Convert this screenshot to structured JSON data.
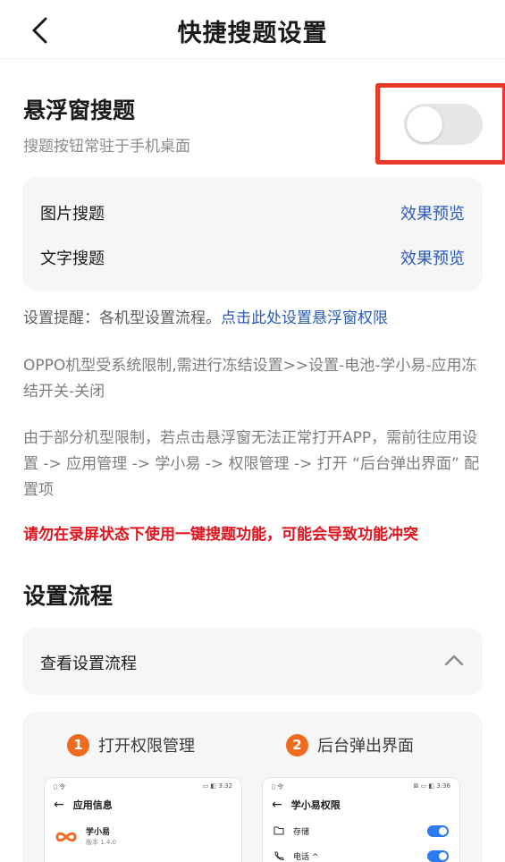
{
  "header": {
    "title": "快捷搜题设置",
    "back_icon": "chevron-left-icon"
  },
  "floating": {
    "title": "悬浮窗搜题",
    "subtitle": "搜题按钮常驻于手机桌面",
    "toggle_on": false,
    "highlight_color": "#e8392b"
  },
  "search_types": [
    {
      "label": "图片搜题",
      "action": "效果预览"
    },
    {
      "label": "文字搜题",
      "action": "效果预览"
    }
  ],
  "notes": {
    "reminder_prefix": "设置提醒：各机型设置流程。",
    "reminder_link": "点击此处设置悬浮窗权限",
    "oppo": "OPPO机型受系统限制,需进行冻结设置>>设置-电池-学小易-应用冻结开关-关闭",
    "model": "由于部分机型限制，若点击悬浮窗无法正常打开APP，需前往应用设置 -> 应用管理 -> 学小易 -> 权限管理 -> 打开 “后台弹出界面” 配置项",
    "warning": "请勿在录屏状态下使用一键搜题功能，可能会导致功能冲突"
  },
  "flow": {
    "section_title": "设置流程",
    "view_label": "查看设置流程",
    "steps": [
      {
        "num": "1",
        "label": "打开权限管理"
      },
      {
        "num": "2",
        "label": "后台弹出界面"
      }
    ],
    "phone1": {
      "status_left": "▯ 令",
      "status_right": "▭ ◧ 3:32",
      "header": "应用信息",
      "app_name": "学小易",
      "app_version": "版本 1.4.0"
    },
    "phone2": {
      "status_left": "▯ 令",
      "status_right": "⊠ ▭ ◧ 3:36",
      "header": "学小易权限",
      "rows": [
        "存储",
        "电话 ^"
      ]
    }
  },
  "colors": {
    "link": "#2a5bb8",
    "warning": "#e0141e",
    "step_badge": "#f06a1f",
    "switch_on": "#2d7bf0"
  }
}
